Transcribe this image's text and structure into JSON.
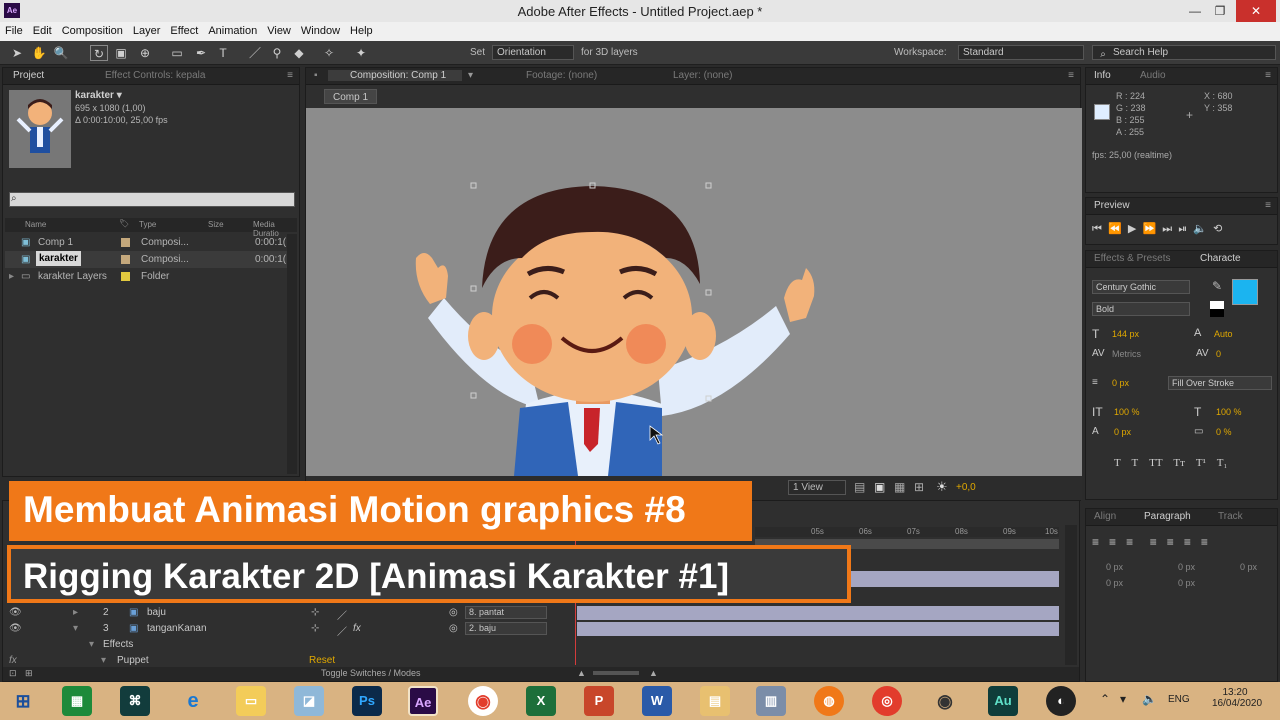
{
  "window": {
    "title": "Adobe After Effects - Untitled Project.aep *",
    "app_icon": "Ae",
    "minimize": "—",
    "maximize": "❐",
    "close": "✕"
  },
  "menu": [
    "File",
    "Edit",
    "Composition",
    "Layer",
    "Effect",
    "Animation",
    "View",
    "Window",
    "Help"
  ],
  "toolbar": {
    "set_label": "Set",
    "orientation_value": "Orientation",
    "for3d_label": "for 3D layers",
    "workspace_label": "Workspace:",
    "workspace_value": "Standard",
    "search_placeholder": "Search Help"
  },
  "project_panel": {
    "tab_project": "Project",
    "tab_effect_controls": "Effect Controls: kepala",
    "item_name": "karakter ▾",
    "item_dims": "695 x 1080 (1,00)",
    "item_duration": "Δ 0:00:10:00, 25,00 fps",
    "col_name": "Name",
    "col_type": "Type",
    "col_size": "Size",
    "col_duration": "Media Duratio",
    "rows": [
      {
        "name": "Comp 1",
        "type": "Composi...",
        "duration": "0:00:1(",
        "color": "#c4a87c"
      },
      {
        "name": "karakter",
        "type": "Composi...",
        "duration": "0:00:1(",
        "color": "#c4a87c"
      },
      {
        "name": "karakter Layers",
        "type": "Folder",
        "duration": "",
        "color": "#e2c93f"
      }
    ]
  },
  "comp_panel": {
    "tab_comp": "Composition: Comp 1",
    "tab_footage": "Footage: (none)",
    "tab_layer": "Layer: (none)",
    "breadcrumb": "Comp 1",
    "view_select": "1 View",
    "exposure": "+0,0",
    "bg_color": "#8c8c8c"
  },
  "info_panel": {
    "tab_info": "Info",
    "tab_audio": "Audio",
    "r": "R : 224",
    "g": "G : 238",
    "b": "B : 255",
    "a": "A : 255",
    "x": "X : 680",
    "y": "Y : 358",
    "fps": "fps: 25,00 (realtime)"
  },
  "preview_panel": {
    "tab": "Preview"
  },
  "character_panel": {
    "tab_effects": "Effects & Presets",
    "tab_character": "Characte",
    "font": "Century Gothic",
    "style": "Bold",
    "size": "144 px",
    "leading": "Auto",
    "kerning": "Metrics",
    "tracking": "0",
    "stroke": "0 px",
    "stroke_type": "Fill Over Stroke",
    "vscale": "100 %",
    "hscale": "100 %",
    "baseline": "0 px",
    "tsume": "0 %",
    "fill_color": "#1bb4f0"
  },
  "paragraph_panel": {
    "tab_align": "Align",
    "tab_paragraph": "Paragraph",
    "tab_tracker": "Track",
    "v1": "0 px",
    "v2": "0 px",
    "v3": "0 px",
    "v4": "0 px",
    "v5": "0 px"
  },
  "timeline": {
    "ticks": [
      "05s",
      "06s",
      "07s",
      "08s",
      "09s",
      "10s"
    ],
    "layers": [
      {
        "num": "2",
        "name": "baju",
        "parent": "8. pantat"
      },
      {
        "num": "3",
        "name": "tanganKanan",
        "parent": "2. baju"
      }
    ],
    "effects_label": "Effects",
    "puppet_label": "Puppet",
    "reset_label": "Reset",
    "toggle_label": "Toggle Switches / Modes"
  },
  "banner": {
    "line1": "Membuat Animasi Motion graphics #8",
    "line2": "Rigging Karakter 2D [Animasi Karakter #1]",
    "color": "#f07818"
  },
  "taskbar": {
    "apps": [
      "Ps",
      "Ae",
      "X",
      "P",
      "W",
      "Au"
    ],
    "lang": "ENG",
    "time": "13:20",
    "date": "16/04/2020"
  }
}
